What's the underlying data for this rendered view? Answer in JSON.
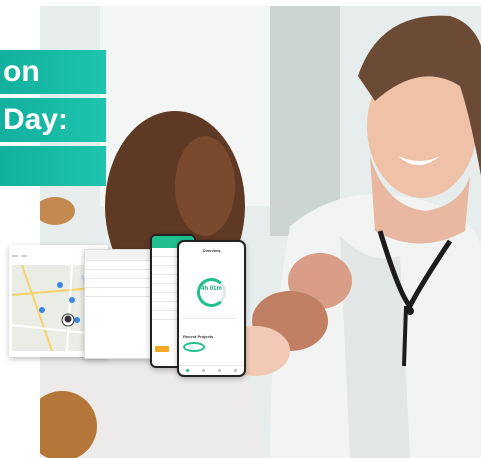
{
  "banner": {
    "line1": "on",
    "line2": "Day:",
    "line3": ""
  },
  "phone_screen": {
    "header": "Overview",
    "timer": "4h 01m",
    "section": "Recent Projects"
  },
  "colors": {
    "banner": "#18b8a5",
    "accent": "#1fbf8f"
  }
}
